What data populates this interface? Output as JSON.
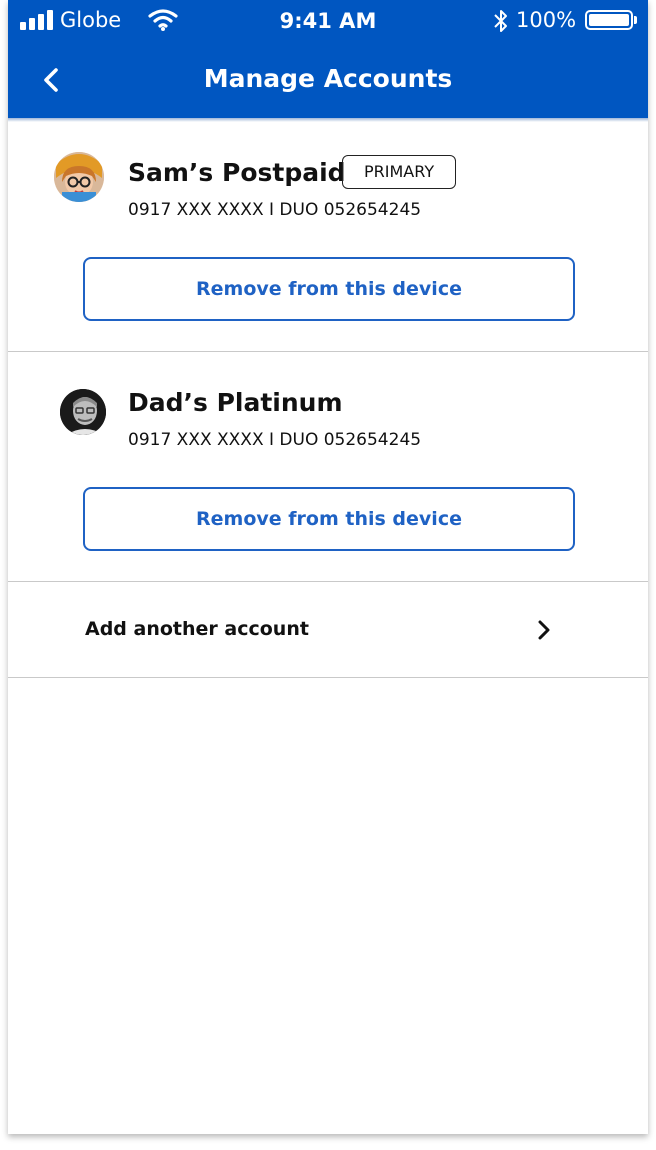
{
  "status_bar": {
    "carrier": "Globe",
    "time": "9:41 AM",
    "battery": "100%",
    "battery_level": 1.0
  },
  "header": {
    "title": "Manage Accounts",
    "back_icon": "chevron-left-icon"
  },
  "accounts": [
    {
      "name": "Sam’s Postpaid",
      "badge": "PRIMARY",
      "numbers": "0917 XXX XXXX   I   DUO 052654245",
      "action_label": "Remove from this device"
    },
    {
      "name": "Dad’s Platinum",
      "numbers": "0917 XXX XXXX   I   DUO 052654245",
      "action_label": "Remove from this device"
    }
  ],
  "add_account": {
    "label": "Add another account",
    "icon": "chevron-right-icon"
  },
  "colors": {
    "header_bg": "#0056c1",
    "accent": "#1f62c4",
    "divider": "#c9c9c9"
  }
}
